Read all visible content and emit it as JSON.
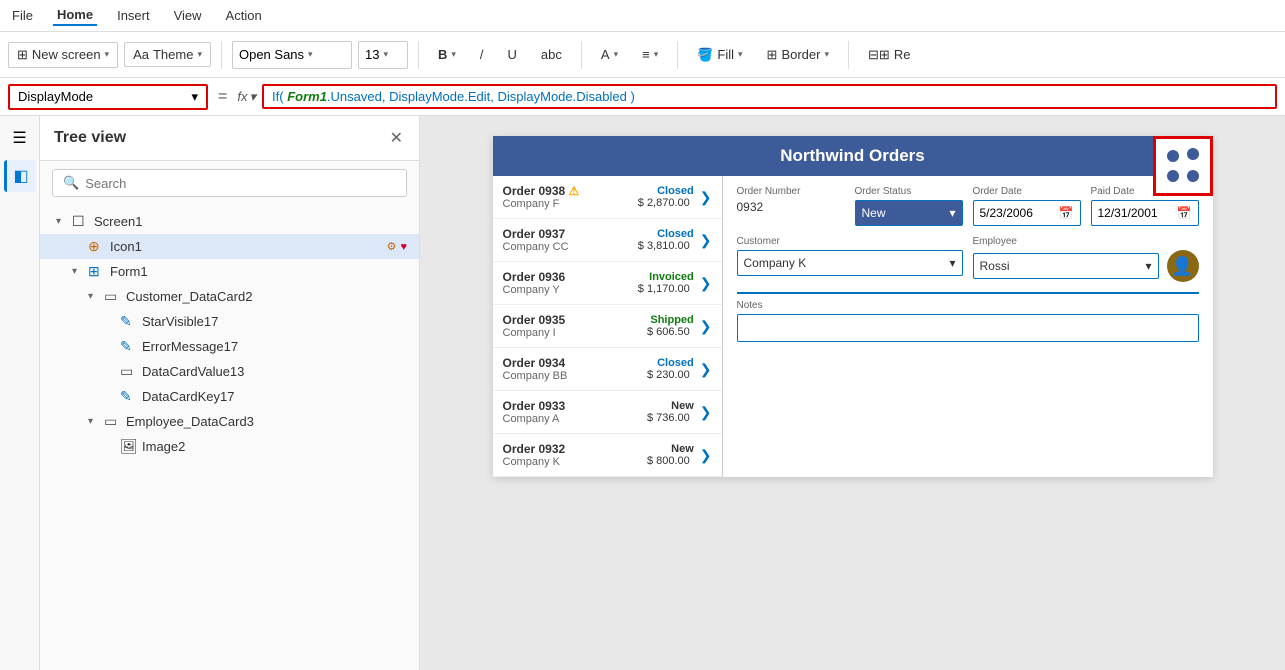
{
  "menubar": {
    "items": [
      {
        "label": "File",
        "active": false
      },
      {
        "label": "Home",
        "active": true
      },
      {
        "label": "Insert",
        "active": false
      },
      {
        "label": "View",
        "active": false
      },
      {
        "label": "Action",
        "active": false
      }
    ]
  },
  "ribbon": {
    "new_screen_label": "New screen",
    "theme_label": "Theme",
    "font_name": "Open Sans",
    "font_size": "13",
    "bold_icon": "B",
    "italic_icon": "/",
    "underline_icon": "U",
    "strikethrough_icon": "abc",
    "font_color_icon": "A",
    "align_icon": "≡",
    "fill_label": "Fill",
    "border_label": "Border",
    "reorder_icon": "Re"
  },
  "formula_bar": {
    "name_box_value": "DisplayMode",
    "formula_text": "If( Form1.Unsaved, DisplayMode.Edit, DisplayMode.Disabled )"
  },
  "tree_view": {
    "title": "Tree view",
    "search_placeholder": "Search",
    "items": [
      {
        "id": "screen1",
        "label": "Screen1",
        "level": 0,
        "type": "screen",
        "expanded": true,
        "icon": "☐"
      },
      {
        "id": "icon1",
        "label": "Icon1",
        "level": 1,
        "type": "icon",
        "expanded": false,
        "icon": "⊕",
        "badges": [
          "gear",
          "heart"
        ]
      },
      {
        "id": "form1",
        "label": "Form1",
        "level": 1,
        "type": "form",
        "expanded": true,
        "icon": "⊞"
      },
      {
        "id": "customer_datacard2",
        "label": "Customer_DataCard2",
        "level": 2,
        "type": "datacard",
        "expanded": true,
        "icon": "▭"
      },
      {
        "id": "starvisible17",
        "label": "StarVisible17",
        "level": 3,
        "type": "control",
        "icon": "✎"
      },
      {
        "id": "errormessage17",
        "label": "ErrorMessage17",
        "level": 3,
        "type": "control",
        "icon": "✎"
      },
      {
        "id": "datacardvalue13",
        "label": "DataCardValue13",
        "level": 3,
        "type": "control",
        "icon": "▭"
      },
      {
        "id": "datacardkey17",
        "label": "DataCardKey17",
        "level": 3,
        "type": "control",
        "icon": "✎"
      },
      {
        "id": "employee_datacard3",
        "label": "Employee_DataCard3",
        "level": 2,
        "type": "datacard",
        "expanded": true,
        "icon": "▭"
      },
      {
        "id": "image2",
        "label": "Image2",
        "level": 3,
        "type": "image",
        "icon": "🖼"
      }
    ]
  },
  "app_preview": {
    "title": "Northwind Orders",
    "orders": [
      {
        "num": "Order 0938",
        "company": "Company F",
        "amount": "$ 2,870.00",
        "status": "Closed",
        "status_class": "closed",
        "warn": true
      },
      {
        "num": "Order 0937",
        "company": "Company CC",
        "amount": "$ 3,810.00",
        "status": "Closed",
        "status_class": "closed",
        "warn": false
      },
      {
        "num": "Order 0936",
        "company": "Company Y",
        "amount": "$ 1,170.00",
        "status": "Invoiced",
        "status_class": "invoiced",
        "warn": false
      },
      {
        "num": "Order 0935",
        "company": "Company I",
        "amount": "$ 606.50",
        "status": "Shipped",
        "status_class": "shipped",
        "warn": false
      },
      {
        "num": "Order 0934",
        "company": "Company BB",
        "amount": "$ 230.00",
        "status": "Closed",
        "status_class": "closed",
        "warn": false
      },
      {
        "num": "Order 0933",
        "company": "Company A",
        "amount": "$ 736.00",
        "status": "New",
        "status_class": "new",
        "warn": false
      },
      {
        "num": "Order 0932",
        "company": "Company K",
        "amount": "$ 800.00",
        "status": "New",
        "status_class": "new",
        "warn": false
      }
    ],
    "detail": {
      "order_number_label": "Order Number",
      "order_number_value": "0932",
      "order_status_label": "Order Status",
      "order_status_value": "New",
      "order_date_label": "Order Date",
      "order_date_value": "5/23/2006",
      "paid_date_label": "Paid Date",
      "paid_date_value": "12/31/2001",
      "customer_label": "Customer",
      "customer_value": "Company K",
      "employee_label": "Employee",
      "employee_value": "Rossi",
      "notes_label": "Notes",
      "notes_value": ""
    }
  },
  "icons": {
    "search": "🔍",
    "close": "✕",
    "hamburger": "☰",
    "caret_down": "▾",
    "layers": "◧",
    "calendar": "📅",
    "chevron_right": "❯",
    "triangle_down": "▾",
    "warning": "⚠"
  }
}
